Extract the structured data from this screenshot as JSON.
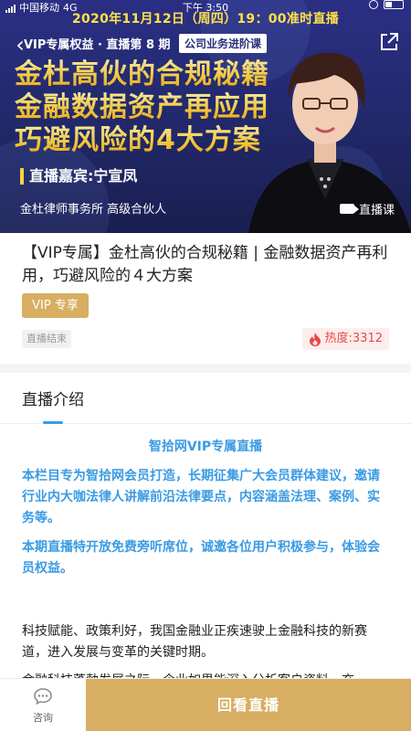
{
  "status_bar": {
    "carrier": "中国移动",
    "network": "4G",
    "time": "下午 3:50"
  },
  "banner": {
    "schedule": "2020年11月12日（周四）19：00准时直播",
    "vip_tag": "VIP专属权益 · 直播第 8 期",
    "session_tag": "公司业务进阶课",
    "headline": [
      "金杜高伙的合规秘籍",
      "金融数据资产再应用",
      "巧避风险的4大方案"
    ],
    "guest": "直播嘉宾:宁宣凤",
    "org": "金杜律师事务所    高级合伙人",
    "live_badge": "直播课",
    "colors": {
      "bg": "#232a6e",
      "headline": "#ffd23c"
    }
  },
  "info": {
    "title": "【VIP专属】金杜高伙的合规秘籍 | 金融数据资产再利用，巧避风险的４大方案",
    "vip_pill": "VIP 专享",
    "status": "直播结束",
    "heat": "热度:3312"
  },
  "section": {
    "title": "直播介绍"
  },
  "intro": {
    "heading": "智拾网VIP专属直播",
    "p1": "本栏目专为智拾网会员打造，长期征集广大会员群体建议，邀请行业内大咖法律人讲解前沿法律要点，内容涵盖法理、案例、实务等。",
    "p2": "本期直播特开放免费旁听席位，诚邀各位用户积极参与，体验会员权益。",
    "b1": "科技赋能、政策利好，我国金融业正疾速驶上金融科技的新赛道，进入发展与变革的关键时期。",
    "b2": "金融科技蓬勃发展之际，企业如果能深入分析客户资料，充"
  },
  "bottom": {
    "consult": "咨询",
    "replay": "回看直播"
  },
  "colors": {
    "accent_gold": "#d7ae62",
    "accent_blue": "#3a9be3",
    "heat_red": "#e94848"
  }
}
